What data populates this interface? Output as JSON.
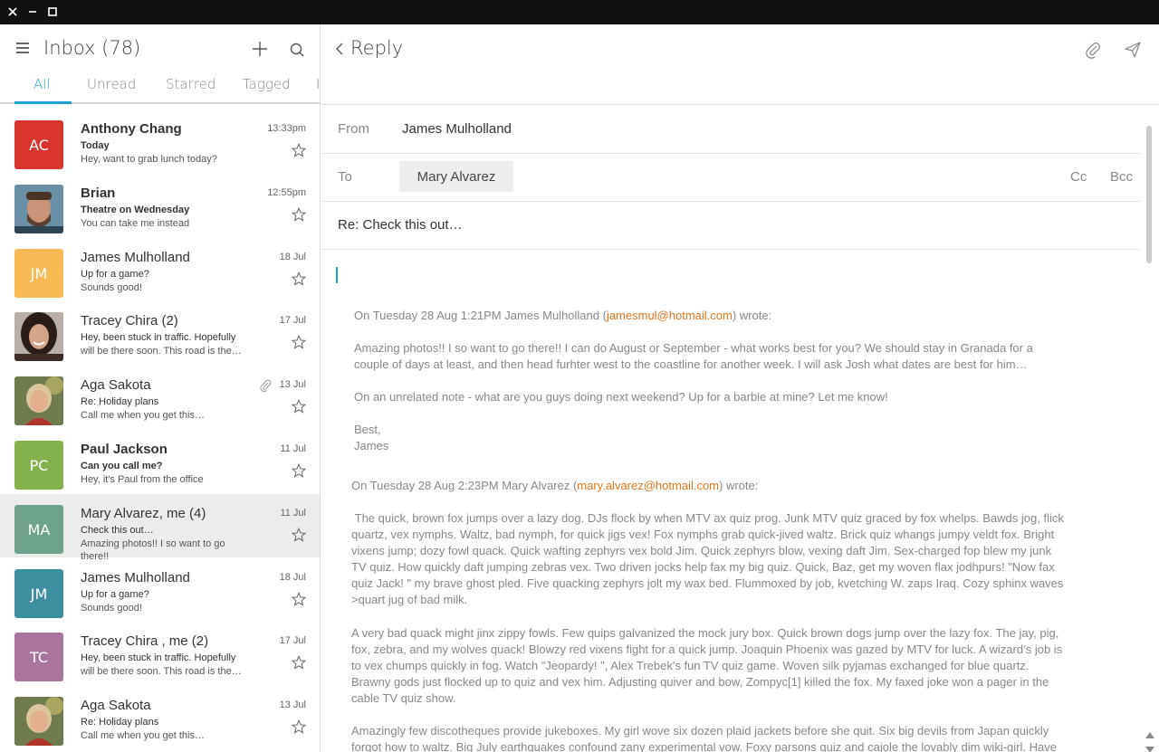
{
  "window": {
    "close": "✕",
    "minimize": "–",
    "maximize": "☐"
  },
  "inbox": {
    "title": "Inbox (78)",
    "tabs": [
      "All",
      "Unread",
      "Starred",
      "Tagged"
    ],
    "active_tab": "All"
  },
  "messages": [
    {
      "initials": "AC",
      "avatar_color": "#d9352a",
      "sender": "Anthony Chang",
      "subject": "Today",
      "preview": "Hey, want to grab lunch today?",
      "date": "13:33pm",
      "bold": true
    },
    {
      "initials": "",
      "avatar_color": "#6b8fa5",
      "avatar_photo": "man-beard-photo",
      "sender": "Brian",
      "subject": "Theatre on Wednesday",
      "preview": "You can take me instead",
      "date": "12:55pm",
      "bold": true
    },
    {
      "initials": "JM",
      "avatar_color": "#f9b955",
      "sender": "James Mulholland",
      "subject": "Up for a game?",
      "preview": "Sounds good!",
      "date": "18 Jul",
      "bold": false
    },
    {
      "initials": "",
      "avatar_color": "#4a3a35",
      "avatar_photo": "woman-smiling-photo",
      "sender": "Tracey Chira (2)",
      "subject": "Hey, been stuck in traffic. Hopefully",
      "preview": "will be there soon. This road is the…",
      "date": "17 Jul",
      "bold": false
    },
    {
      "initials": "",
      "avatar_color": "#6f7a4f",
      "avatar_photo": "woman-outdoors-photo",
      "sender": "Aga Sakota",
      "subject": "Re: Holiday plans",
      "preview": "Call me when you get this…",
      "date": "13 Jul",
      "bold": false,
      "attachment": true
    },
    {
      "initials": "PC",
      "avatar_color": "#85b14c",
      "sender": "Paul Jackson",
      "subject": "Can you call me?",
      "preview": "Hey, it's Paul from the office",
      "date": "11 Jul",
      "bold": true
    },
    {
      "initials": "MA",
      "avatar_color": "#6fa28a",
      "sender": "Mary Alvarez, me (4)",
      "subject": "Check this out…",
      "preview": "Amazing photos!! I so want to go there!!",
      "date": "11 Jul",
      "bold": false,
      "selected": true
    },
    {
      "initials": "JM",
      "avatar_color": "#3e8f9e",
      "sender": "James Mulholland",
      "subject": "Up for a game?",
      "preview": "Sounds good!",
      "date": "18 Jul",
      "bold": false
    },
    {
      "initials": "TC",
      "avatar_color": "#a8769c",
      "sender": "Tracey Chira , me (2)",
      "subject": "Hey, been stuck in traffic. Hopefully",
      "preview": "will be there soon. This road is the…",
      "date": "17 Jul",
      "bold": false
    },
    {
      "initials": "",
      "avatar_color": "#6f7a4f",
      "avatar_photo": "woman-outdoors-photo",
      "sender": "Aga Sakota",
      "subject": "Re: Holiday plans",
      "preview": "Call me when you get this…",
      "date": "13 Jul",
      "bold": false
    }
  ],
  "reply": {
    "title": "Reply",
    "from_label": "From",
    "from_value": "James Mulholland",
    "to_label": "To",
    "to_value": "Mary Alvarez",
    "cc_label": "Cc",
    "bcc_label": "Bcc",
    "subject": "Re: Check this out…"
  },
  "quoted": {
    "q1_header_pre": "On Tuesday 28 Aug 1:21PM James Mulholland (",
    "q1_email": "jamesmul@hotmail.com",
    "q1_header_post": ") wrote:",
    "q1_p1": "Amazing photos!! I so want to go there!! I can do  August or September - what works best for you? We should stay in Granada for a couple of days at least, and then head   furhter west to the coastline for another week. I will ask Josh what dates are best for him…",
    "q1_p2": "On an unrelated note - what are you guys doing next weekend? Up for a barbie at mine? Let me know!",
    "q1_sign1": "Best,",
    "q1_sign2": "James",
    "q2_header_pre": "On Tuesday 28 Aug 2:23PM Mary Alvarez (",
    "q2_email": "mary.alvarez@hotmail.com",
    "q2_header_post": ") wrote:",
    "q2_p1": " The quick, brown fox jumps over a lazy dog. DJs flock by when MTV ax quiz prog. Junk MTV quiz graced by fox whelps. Bawds jog, flick quartz, vex nymphs. Waltz, bad nymph, for quick jigs vex! Fox nymphs grab quick-jived waltz. Brick quiz whangs jumpy veldt fox. Bright vixens jump; dozy fowl quack. Quick wafting zephyrs vex bold Jim. Quick zephyrs blow, vexing daft Jim. Sex-charged fop blew my junk TV quiz. How quickly daft jumping zebras vex. Two driven jocks help fax my big quiz. Quick, Baz, get my woven flax jodhpurs! \"Now fax quiz Jack! \" my brave ghost pled. Five quacking zephyrs jolt my wax bed. Flummoxed by job, kvetching W. zaps Iraq. Cozy sphinx waves >quart jug of bad milk.",
    "q2_p2": "A very bad quack might jinx zippy fowls. Few quips galvanized the mock jury box. Quick brown dogs jump over the lazy fox. The jay, pig, fox, zebra, and my wolves quack! Blowzy red vixens fight for a quick jump. Joaquin Phoenix was gazed by MTV for luck. A wizard’s job is to vex chumps quickly in fog. Watch \"Jeopardy! \", Alex Trebek's fun TV quiz game. Woven silk pyjamas exchanged for blue quartz. Brawny gods just flocked up to quiz and vex him. Adjusting quiver and bow, Zompyc[1] killed the fox. My faxed joke won a pager in the cable TV quiz show.",
    "q2_p3": "Amazingly few discotheques provide jukeboxes. My girl wove six dozen plaid jackets before she quit. Six big devils from Japan quickly forgot how to waltz. Big July earthquakes confound zany experimental vow. Foxy parsons quiz and cajole the lovably dim wiki-girl. Have"
  }
}
